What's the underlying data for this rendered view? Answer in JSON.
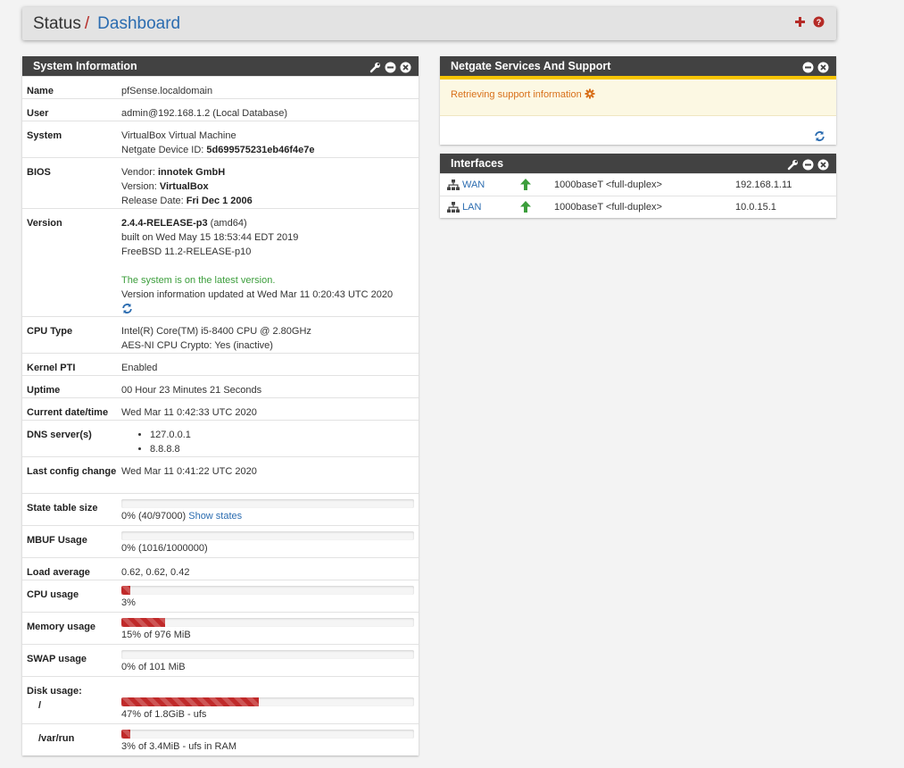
{
  "breadcrumb": {
    "root": "Status",
    "separator": "/",
    "current": "Dashboard"
  },
  "colors": {
    "accent_red": "#b52b27",
    "link_blue": "#2b6cb0",
    "panel_header": "#424242",
    "up_green": "#3c9e3c",
    "warning_orange": "#d8701a"
  },
  "system_info": {
    "title": "System Information",
    "name_label": "Name",
    "name_value": "pfSense.localdomain",
    "user_label": "User",
    "user_value": "admin@192.168.1.2 (Local Database)",
    "system_label": "System",
    "system_line1": "VirtualBox Virtual Machine",
    "system_line2_prefix": "Netgate Device ID: ",
    "system_device_id": "5d699575231eb46f4e7e",
    "bios_label": "BIOS",
    "bios_vendor_prefix": "Vendor: ",
    "bios_vendor": "innotek GmbH",
    "bios_version_prefix": "Version: ",
    "bios_version": "VirtualBox",
    "bios_date_prefix": "Release Date: ",
    "bios_date": "Fri Dec 1 2006",
    "version_label": "Version",
    "version_main": "2.4.4-RELEASE-p3",
    "version_arch": " (amd64)",
    "version_built": "built on Wed May 15 18:53:44 EDT 2019",
    "version_freebsd": "FreeBSD 11.2-RELEASE-p10",
    "version_status": "The system is on the latest version.",
    "version_updated": "Version information updated at Wed Mar 11 0:20:43 UTC 2020",
    "cpu_type_label": "CPU Type",
    "cpu_type_line1": "Intel(R) Core(TM) i5-8400 CPU @ 2.80GHz",
    "cpu_type_line2": "AES-NI CPU Crypto: Yes (inactive)",
    "kernel_pti_label": "Kernel PTI",
    "kernel_pti_value": "Enabled",
    "uptime_label": "Uptime",
    "uptime_value": "00 Hour 23 Minutes 21 Seconds",
    "datetime_label": "Current date/time",
    "datetime_value": "Wed Mar 11 0:42:33 UTC 2020",
    "dns_label": "DNS server(s)",
    "dns_servers": [
      "127.0.0.1",
      "8.8.8.8"
    ],
    "last_config_label": "Last config change",
    "last_config_value": "Wed Mar 11 0:41:22 UTC 2020",
    "state_table_label": "State table size",
    "state_table_text": "0% (40/97000)",
    "state_table_link": "Show states",
    "state_table_pct": 0,
    "mbuf_label": "MBUF Usage",
    "mbuf_text": "0% (1016/1000000)",
    "mbuf_pct": 0,
    "load_label": "Load average",
    "load_value": "0.62, 0.62, 0.42",
    "cpu_usage_label": "CPU usage",
    "cpu_usage_text": "3%",
    "cpu_usage_pct": 3,
    "memory_label": "Memory usage",
    "memory_text": "15% of 976 MiB",
    "memory_pct": 15,
    "swap_label": "SWAP usage",
    "swap_text": "0% of 101 MiB",
    "swap_pct": 0,
    "disk_label": "Disk usage:",
    "disk_root_mount": "/",
    "disk_root_text": "47% of 1.8GiB - ufs",
    "disk_root_pct": 47,
    "disk_var_mount": "/var/run",
    "disk_var_text": "3% of 3.4MiB - ufs in RAM",
    "disk_var_pct": 3
  },
  "netgate": {
    "title": "Netgate Services And Support",
    "message": "Retrieving support information"
  },
  "interfaces": {
    "title": "Interfaces",
    "rows": [
      {
        "name": "WAN",
        "media": "1000baseT <full-duplex>",
        "ip": "192.168.1.11"
      },
      {
        "name": "LAN",
        "media": "1000baseT <full-duplex>",
        "ip": "10.0.15.1"
      }
    ]
  }
}
